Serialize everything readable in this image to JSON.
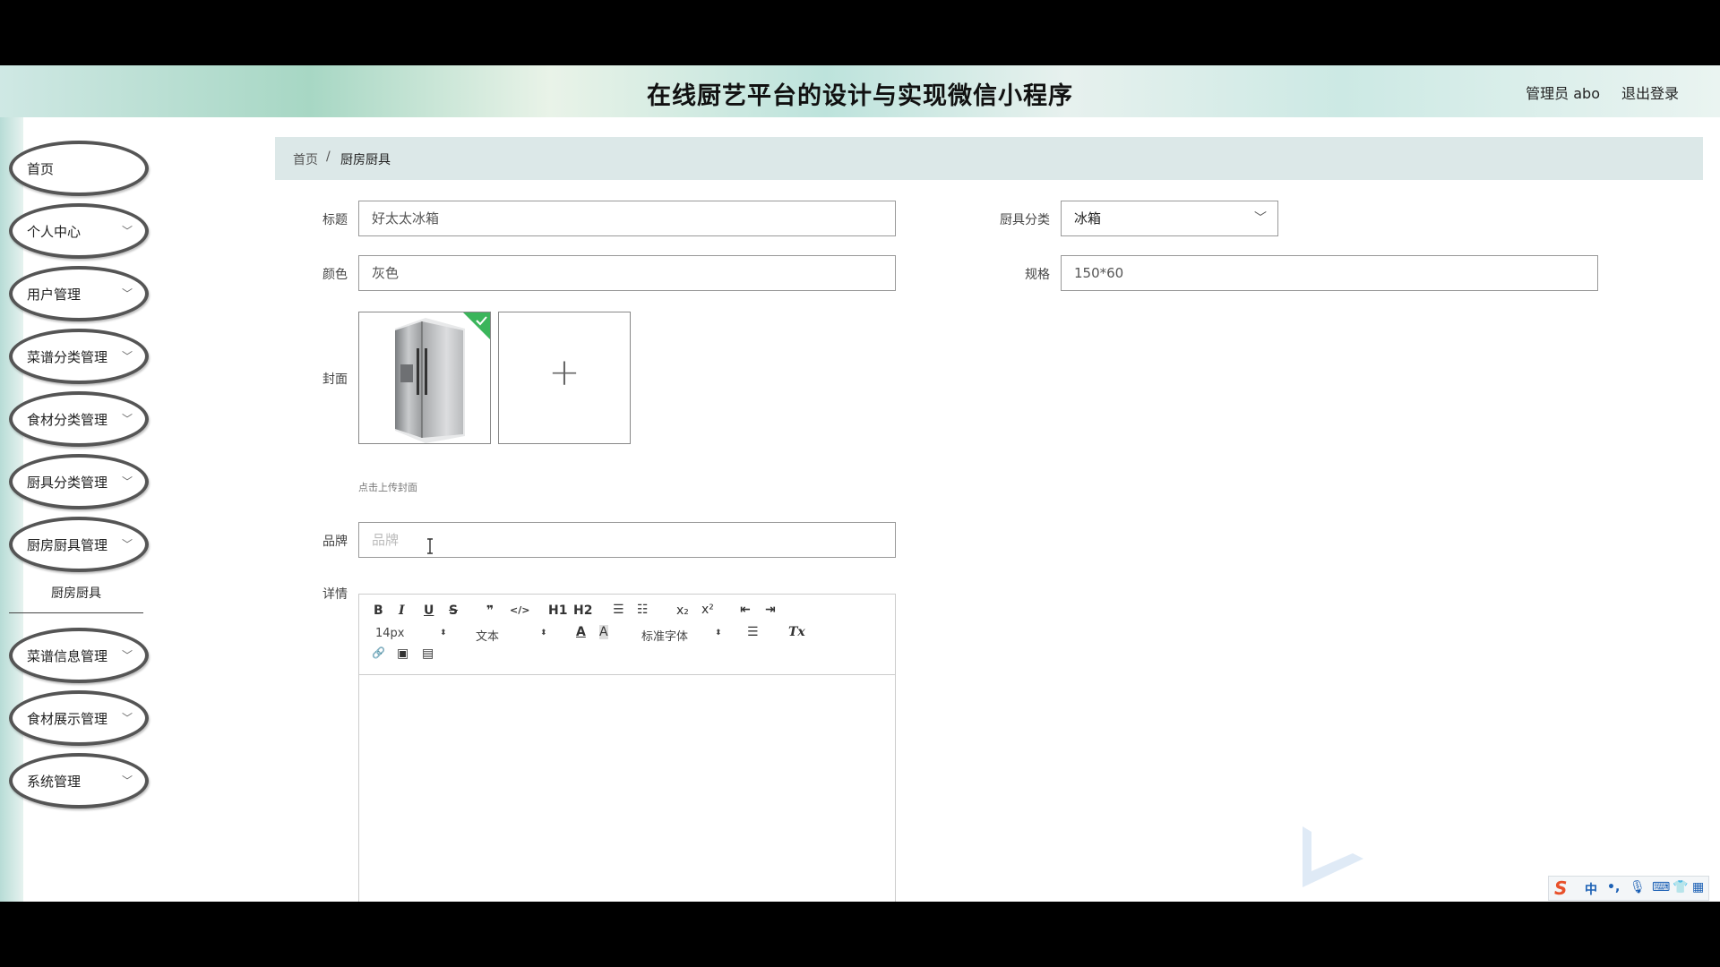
{
  "header": {
    "title": "在线厨艺平台的设计与实现微信小程序",
    "user_label": "管理员 abo",
    "logout_label": "退出登录"
  },
  "sidebar": {
    "items": [
      {
        "label": "首页",
        "has_chevron": false
      },
      {
        "label": "个人中心",
        "has_chevron": true
      },
      {
        "label": "用户管理",
        "has_chevron": true
      },
      {
        "label": "菜谱分类管理",
        "has_chevron": true
      },
      {
        "label": "食材分类管理",
        "has_chevron": true
      },
      {
        "label": "厨具分类管理",
        "has_chevron": true
      },
      {
        "label": "厨房厨具管理",
        "has_chevron": true,
        "expanded": true
      },
      {
        "label": "菜谱信息管理",
        "has_chevron": true
      },
      {
        "label": "食材展示管理",
        "has_chevron": true
      },
      {
        "label": "系统管理",
        "has_chevron": true
      }
    ],
    "subitem": {
      "label": "厨房厨具"
    }
  },
  "breadcrumb": {
    "home": "首页",
    "separator": "/",
    "current": "厨房厨具"
  },
  "form": {
    "title": {
      "label": "标题",
      "value": "好太太冰箱"
    },
    "category": {
      "label": "厨具分类",
      "value": "冰箱"
    },
    "color": {
      "label": "颜色",
      "value": "灰色"
    },
    "spec": {
      "label": "规格",
      "value": "150*60"
    },
    "cover": {
      "label": "封面",
      "hint": "点击上传封面",
      "plus": "+"
    },
    "brand": {
      "label": "品牌",
      "placeholder": "品牌"
    },
    "detail": {
      "label": "详情"
    }
  },
  "editor_toolbar": {
    "bold": "B",
    "italic": "I",
    "underline": "U",
    "strike": "S",
    "quote": "❞",
    "code": "</>",
    "h1": "H1",
    "h2": "H2",
    "ordered_list": "☰",
    "bullet_list": "☷",
    "subscript": "x₂",
    "superscript": "x²",
    "outdent": "⇤",
    "indent": "⇥",
    "size": "14px",
    "format": "文本",
    "font_color": "A",
    "bg_color": "A",
    "font": "标准字体",
    "align": "☰",
    "clear": "Tx",
    "link": "🔗",
    "image": "▣",
    "video": "▤"
  },
  "ime": {
    "logo": "S",
    "mode": "中",
    "punct": "•,",
    "mic": "🎙",
    "kbd": "⌨",
    "skin": "👕",
    "grid": "▦"
  },
  "colors": {
    "accent_green": "#3bb55b",
    "breadcrumb_bg": "#dce8e8",
    "sidebar_border": "#555555"
  }
}
